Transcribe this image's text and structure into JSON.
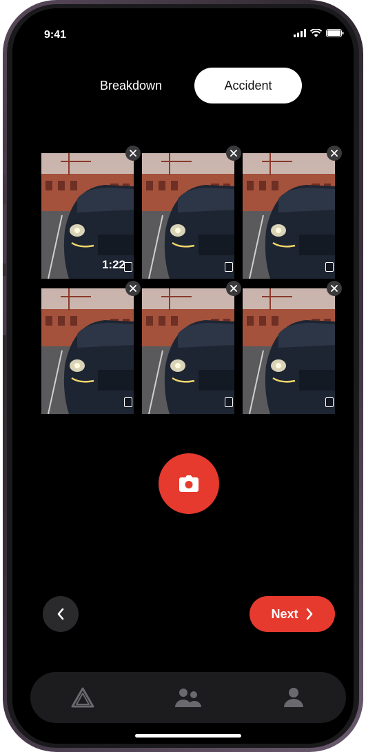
{
  "status_bar": {
    "time": "9:41",
    "icons": [
      "signal-icon",
      "wifi-icon",
      "battery-icon"
    ]
  },
  "segment": {
    "options": [
      "Breakdown",
      "Accident"
    ],
    "selected": "Accident"
  },
  "photos": [
    {
      "type": "video",
      "duration": "1:22"
    },
    {
      "type": "photo"
    },
    {
      "type": "photo"
    },
    {
      "type": "photo"
    },
    {
      "type": "photo"
    },
    {
      "type": "photo"
    }
  ],
  "capture": {
    "icon": "camera-icon"
  },
  "navigation": {
    "back_icon": "chevron-left-icon",
    "next_label": "Next",
    "next_icon": "chevron-right-icon"
  },
  "tab_bar": {
    "items": [
      "triangle-icon",
      "people-icon",
      "profile-icon"
    ]
  },
  "colors": {
    "accent": "#e63a2e",
    "background": "#000000",
    "surface": "#1c1c1e"
  }
}
